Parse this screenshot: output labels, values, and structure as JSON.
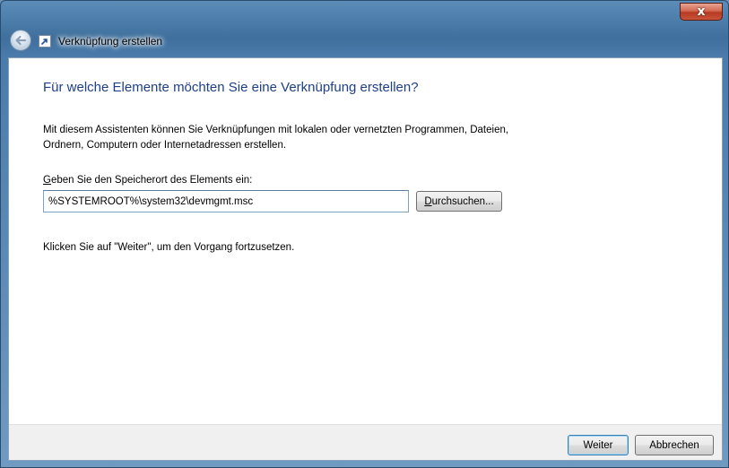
{
  "window": {
    "title": "Verknüpfung erstellen",
    "close_label": "x"
  },
  "content": {
    "heading": "Für welche Elemente möchten Sie eine Verknüpfung erstellen?",
    "description_line1": "Mit diesem Assistenten können Sie Verknüpfungen mit lokalen oder vernetzten Programmen, Dateien,",
    "description_line2": "Ordnern, Computern oder Internetadressen erstellen.",
    "location_label_accel": "G",
    "location_label_rest": "eben Sie den Speicherort des Elements ein:",
    "location_value": "%SYSTEMROOT%\\system32\\devmgmt.msc",
    "browse_accel": "D",
    "browse_rest": "urchsuchen...",
    "hint": "Klicken Sie auf \"Weiter\", um den Vorgang fortzusetzen."
  },
  "footer": {
    "next_label": "Weiter",
    "cancel_label": "Abbrechen"
  },
  "icons": {
    "back": "back-arrow-icon",
    "wizard": "shortcut-arrow-icon",
    "close": "close-icon"
  }
}
